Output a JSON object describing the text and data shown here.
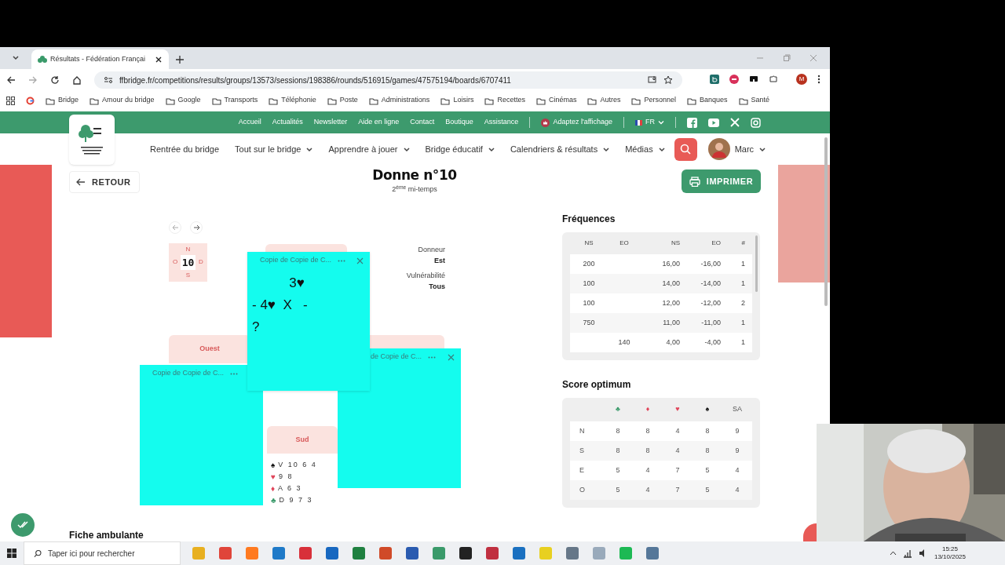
{
  "browser": {
    "tab_title": "Résultats - Fédération Françai",
    "url": "ffbridge.fr/competitions/results/groups/13573/sessions/198386/rounds/516915/games/47575194/boards/6707411",
    "bookmarks": [
      "Bridge",
      "Amour du bridge",
      "Google",
      "Transports",
      "Téléphonie",
      "Poste",
      "Administrations",
      "Loisirs",
      "Recettes",
      "Cinémas",
      "Autres",
      "Personnel",
      "Banques",
      "Santé"
    ],
    "profile_initial": "M"
  },
  "site": {
    "top_links": [
      "Accueil",
      "Actualités",
      "Newsletter",
      "Aide en ligne",
      "Contact",
      "Boutique",
      "Assistance"
    ],
    "display_toggle": "Adaptez l'affichage",
    "language": "FR",
    "main_nav": [
      "Rentrée du bridge",
      "Tout sur le bridge",
      "Apprendre à jouer",
      "Bridge éducatif",
      "Calendriers & résultats",
      "Médias"
    ],
    "user": "Marc"
  },
  "board": {
    "back": "RETOUR",
    "title": "Donne n°10",
    "subtitle": "2$^{ème}$ mi-temps",
    "print": "IMPRIMER",
    "compass": {
      "north": "N",
      "south": "S",
      "west": "O",
      "east": "D",
      "number": "10"
    },
    "dealer_label": "Donneur",
    "dealer": "Est",
    "vulnerability_label": "Vulnérabilité",
    "vulnerability": "Tous",
    "west_title": "Ouest",
    "south_title": "Sud",
    "south_cards": [
      {
        "suit": "♠",
        "color": "#111111",
        "cards": "V 10 6 4"
      },
      {
        "suit": "♥",
        "color": "#e0455a",
        "cards": "9 8"
      },
      {
        "suit": "♦",
        "color": "#e0455a",
        "cards": "A 6 3"
      },
      {
        "suit": "♣",
        "color": "#3a9a6a",
        "cards": "D 9 7 3"
      }
    ]
  },
  "sticky_notes": [
    {
      "title": "Copie de Copie de C...",
      "closable": false
    },
    {
      "title": "de Copie de C...",
      "closable": true
    },
    {
      "title": "Copie de Copie de C...",
      "closable": true,
      "lines": [
        "          3♥",
        "- 4♥  X   -",
        "?"
      ]
    }
  ],
  "frequences": {
    "title": "Fréquences",
    "columns": [
      "NS",
      "EO",
      "NS",
      "EO",
      "#"
    ],
    "rows": [
      [
        "200",
        "",
        "16,00",
        "-16,00",
        "1"
      ],
      [
        "100",
        "",
        "14,00",
        "-14,00",
        "1"
      ],
      [
        "100",
        "",
        "12,00",
        "-12,00",
        "2"
      ],
      [
        "750",
        "",
        "11,00",
        "-11,00",
        "1"
      ],
      [
        "",
        "140",
        "4,00",
        "-4,00",
        "1"
      ]
    ]
  },
  "score_optimum": {
    "title": "Score optimum",
    "columns": [
      {
        "kind": "blank"
      },
      {
        "label": "♣",
        "color": "#3a9a6a"
      },
      {
        "label": "♦",
        "color": "#e0455a"
      },
      {
        "label": "♥",
        "color": "#e0455a"
      },
      {
        "label": "♠",
        "color": "#111111"
      },
      {
        "label": "SA"
      }
    ],
    "rows": [
      [
        "N",
        "8",
        "8",
        "4",
        "8",
        "9"
      ],
      [
        "S",
        "8",
        "8",
        "4",
        "8",
        "9"
      ],
      [
        "E",
        "5",
        "4",
        "7",
        "5",
        "4"
      ],
      [
        "O",
        "5",
        "4",
        "7",
        "5",
        "4"
      ]
    ]
  },
  "fiche_title": "Fiche ambulante",
  "taskbar": {
    "search_placeholder": "Taper ici pour rechercher",
    "time": "15:25",
    "date": "13/10/2025"
  }
}
